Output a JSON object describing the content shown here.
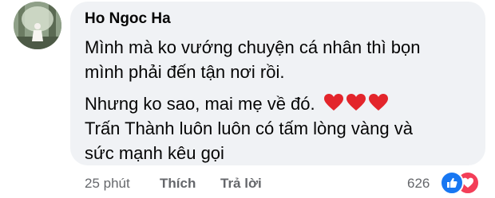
{
  "comment": {
    "author": "Ho Ngoc Ha",
    "lines": [
      "Mình mà ko vướng chuyện cá nhân thì bọn",
      "mình phải đến  tận nơi rồi.",
      "Nhưng ko sao, mai mẹ về đó.",
      "Trấn Thành luôn luôn có tấm lòng vàng và",
      "sức mạnh kêu gọi"
    ],
    "emoji": [
      "red-heart",
      "red-heart",
      "red-heart"
    ]
  },
  "meta": {
    "time": "25 phút",
    "like_label": "Thích",
    "reply_label": "Trả lời",
    "reaction_count": "626",
    "reactions": [
      "like",
      "love"
    ]
  },
  "colors": {
    "bubble": "#f0f2f5",
    "text": "#050505",
    "secondary": "#65676b",
    "like_blue": "#1877f2",
    "love_red": "#f33e58",
    "heart_red": "#e3252b"
  }
}
